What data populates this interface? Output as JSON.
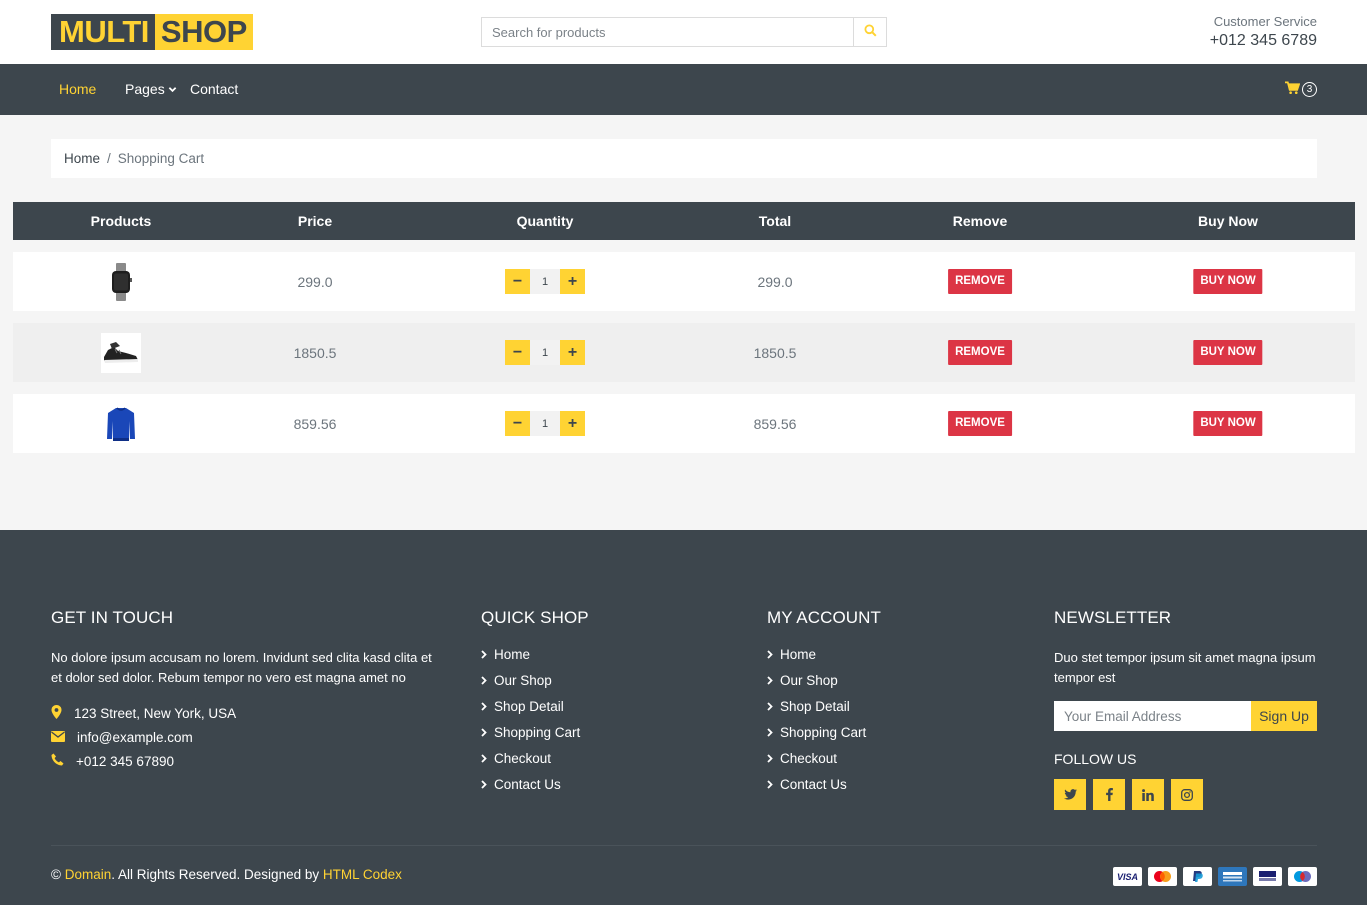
{
  "header": {
    "logo_part1": "MULTI",
    "logo_part2": "SHOP",
    "search_placeholder": "Search for products",
    "customer_service_label": "Customer Service",
    "customer_service_phone": "+012 345 6789"
  },
  "nav": {
    "home": "Home",
    "pages": "Pages",
    "contact": "Contact",
    "cart_count": "3"
  },
  "breadcrumb": {
    "home": "Home",
    "separator": "/",
    "current": "Shopping Cart"
  },
  "cart_table": {
    "headers": [
      "Products",
      "Price",
      "Quantity",
      "Total",
      "Remove",
      "Buy Now"
    ],
    "rows": [
      {
        "product_icon": "smartwatch",
        "price": "299.0",
        "quantity": "1",
        "total": "299.0",
        "remove_label": "REMOVE",
        "buy_label": "BUY NOW"
      },
      {
        "product_icon": "sneaker",
        "price": "1850.5",
        "quantity": "1",
        "total": "1850.5",
        "remove_label": "REMOVE",
        "buy_label": "BUY NOW"
      },
      {
        "product_icon": "blue-sweater",
        "price": "859.56",
        "quantity": "1",
        "total": "859.56",
        "remove_label": "REMOVE",
        "buy_label": "BUY NOW"
      }
    ]
  },
  "footer": {
    "get_in_touch": {
      "title": "GET IN TOUCH",
      "text": "No dolore ipsum accusam no lorem. Invidunt sed clita kasd clita et et dolor sed dolor. Rebum tempor no vero est magna amet no",
      "address": "123 Street, New York, USA",
      "email": "info@example.com",
      "phone": "+012 345 67890"
    },
    "quick_shop": {
      "title": "QUICK SHOP",
      "links": [
        "Home",
        "Our Shop",
        "Shop Detail",
        "Shopping Cart",
        "Checkout",
        "Contact Us"
      ]
    },
    "my_account": {
      "title": "MY ACCOUNT",
      "links": [
        "Home",
        "Our Shop",
        "Shop Detail",
        "Shopping Cart",
        "Checkout",
        "Contact Us"
      ]
    },
    "newsletter": {
      "title": "NEWSLETTER",
      "text": "Duo stet tempor ipsum sit amet magna ipsum tempor est",
      "email_placeholder": "Your Email Address",
      "signup_label": "Sign Up",
      "follow_title": "FOLLOW US",
      "social_icons": [
        "twitter-icon",
        "facebook-icon",
        "linkedin-icon",
        "instagram-icon"
      ]
    },
    "copyright": {
      "symbol": "©",
      "domain": "Domain",
      "rights": ". All Rights Reserved. Designed by",
      "designer": "HTML Codex"
    },
    "payment_icons": [
      "visa",
      "mastercard",
      "paypal",
      "american-express",
      "visa-electron",
      "maestro"
    ]
  },
  "colors": {
    "dark": "#3D464D",
    "accent": "#FFD333",
    "danger": "#DC3545",
    "bg": "#F5F5F5"
  }
}
